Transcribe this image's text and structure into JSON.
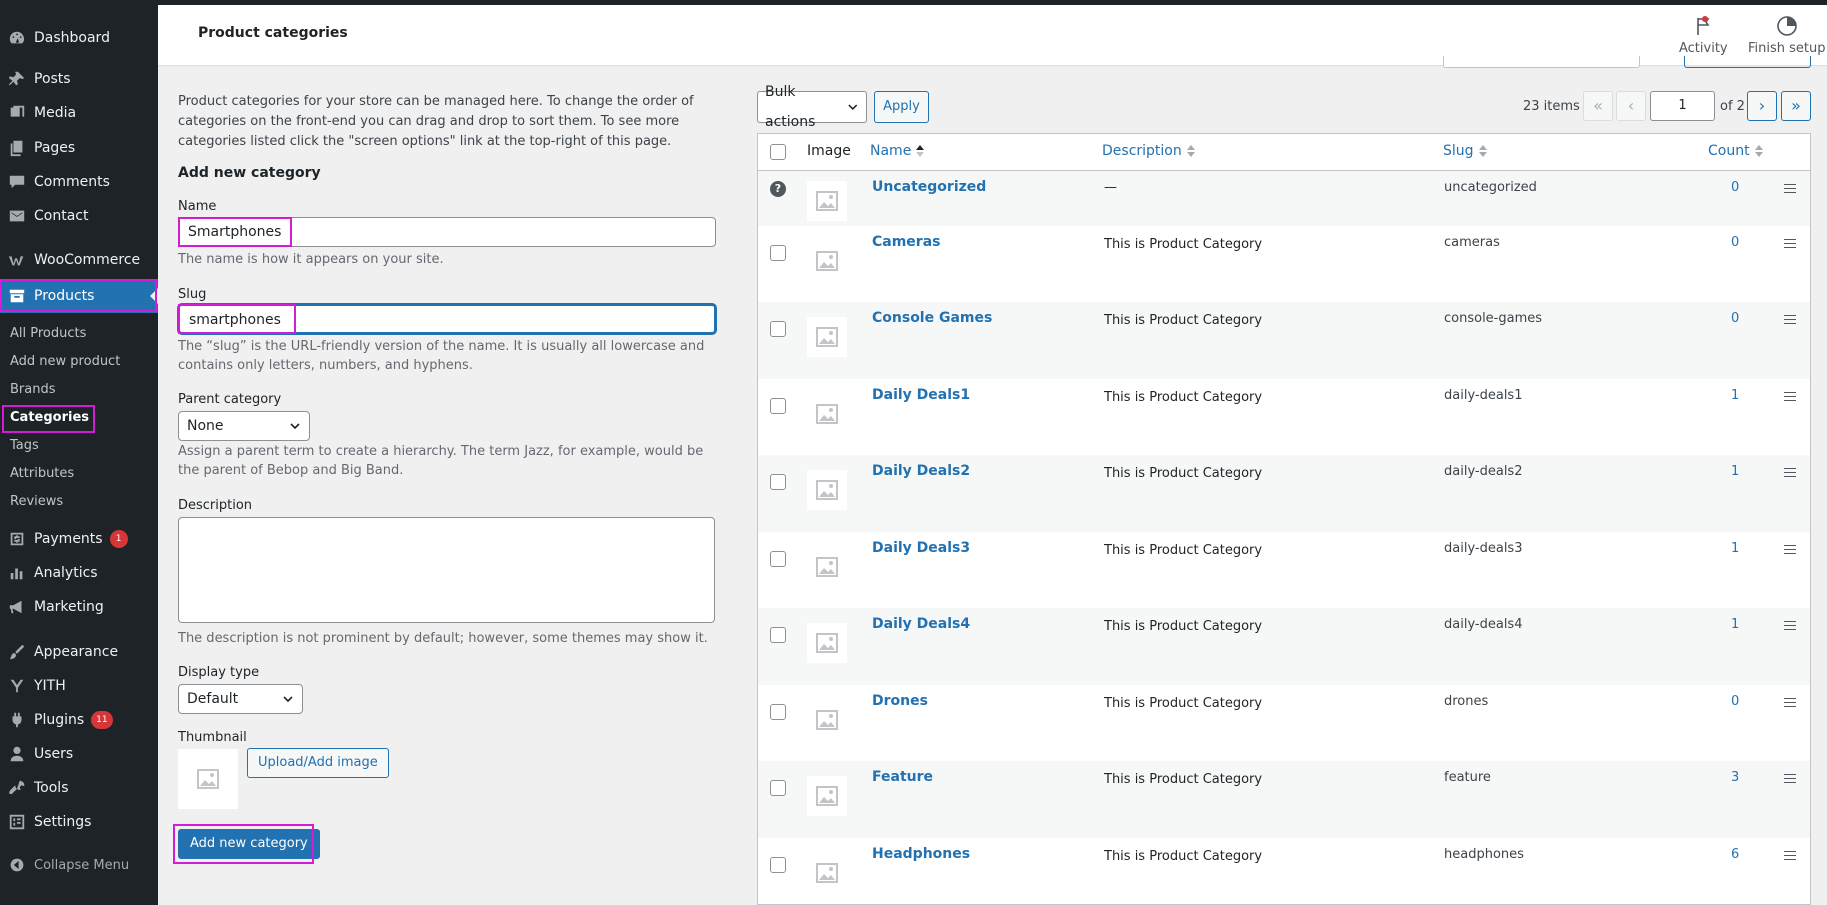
{
  "header": {
    "title": "Product categories",
    "activity_label": "Activity",
    "finish_setup_label": "Finish setup"
  },
  "sidebar": {
    "items": [
      {
        "label": "Dashboard",
        "icon": "dashboard-icon"
      },
      {
        "label": "Posts",
        "icon": "pin-icon"
      },
      {
        "label": "Media",
        "icon": "media-icon"
      },
      {
        "label": "Pages",
        "icon": "pages-icon"
      },
      {
        "label": "Comments",
        "icon": "comment-icon"
      },
      {
        "label": "Contact",
        "icon": "mail-icon"
      },
      {
        "label": "WooCommerce",
        "icon": "woo-icon"
      },
      {
        "label": "Products",
        "icon": "archive-icon"
      },
      {
        "label": "Payments",
        "icon": "payments-icon",
        "badge": "1"
      },
      {
        "label": "Analytics",
        "icon": "chart-icon"
      },
      {
        "label": "Marketing",
        "icon": "megaphone-icon"
      },
      {
        "label": "Appearance",
        "icon": "brush-icon"
      },
      {
        "label": "YITH",
        "icon": "yith-icon"
      },
      {
        "label": "Plugins",
        "icon": "plug-icon",
        "badge": "11"
      },
      {
        "label": "Users",
        "icon": "user-icon"
      },
      {
        "label": "Tools",
        "icon": "wrench-icon"
      },
      {
        "label": "Settings",
        "icon": "settings-icon"
      }
    ],
    "submenu": [
      "All Products",
      "Add new product",
      "Brands",
      "Categories",
      "Tags",
      "Attributes",
      "Reviews"
    ],
    "collapse_label": "Collapse Menu"
  },
  "form": {
    "intro": "Product categories for your store can be managed here. To change the order of categories on the front-end you can drag and drop to sort them. To see more categories listed click the \"screen options\" link at the top-right of this page.",
    "heading": "Add new category",
    "name_label": "Name",
    "name_value": "Smartphones",
    "name_help": "The name is how it appears on your site.",
    "slug_label": "Slug",
    "slug_value": "smartphones",
    "slug_help": "The “slug” is the URL-friendly version of the name. It is usually all lowercase and contains only letters, numbers, and hyphens.",
    "parent_label": "Parent category",
    "parent_value": "None",
    "parent_help": "Assign a parent term to create a hierarchy. The term Jazz, for example, would be the parent of Bebop and Big Band.",
    "description_label": "Description",
    "description_help": "The description is not prominent by default; however, some themes may show it.",
    "display_type_label": "Display type",
    "display_type_value": "Default",
    "thumbnail_label": "Thumbnail",
    "upload_button": "Upload/Add image",
    "submit_button": "Add new category"
  },
  "table": {
    "bulk_actions": "Bulk actions",
    "apply": "Apply",
    "items_count": "23 items",
    "pagination": {
      "first": "«",
      "prev": "‹",
      "current_page": "1",
      "of_pages": "of 2",
      "next": "›",
      "last": "»"
    },
    "columns": {
      "image": "Image",
      "name": "Name",
      "description": "Description",
      "slug": "Slug",
      "count": "Count"
    },
    "rows": [
      {
        "name": "Uncategorized",
        "description": "—",
        "slug": "uncategorized",
        "count": "0"
      },
      {
        "name": "Cameras",
        "description": "This is Product Category",
        "slug": "cameras",
        "count": "0"
      },
      {
        "name": "Console Games",
        "description": "This is Product Category",
        "slug": "console-games",
        "count": "0"
      },
      {
        "name": "Daily Deals1",
        "description": "This is Product Category",
        "slug": "daily-deals1",
        "count": "1"
      },
      {
        "name": "Daily Deals2",
        "description": "This is Product Category",
        "slug": "daily-deals2",
        "count": "1"
      },
      {
        "name": "Daily Deals3",
        "description": "This is Product Category",
        "slug": "daily-deals3",
        "count": "1"
      },
      {
        "name": "Daily Deals4",
        "description": "This is Product Category",
        "slug": "daily-deals4",
        "count": "1"
      },
      {
        "name": "Drones",
        "description": "This is Product Category",
        "slug": "drones",
        "count": "0"
      },
      {
        "name": "Feature",
        "description": "This is Product Category",
        "slug": "feature",
        "count": "3"
      },
      {
        "name": "Headphones",
        "description": "This is Product Category",
        "slug": "headphones",
        "count": "6"
      }
    ]
  },
  "colors": {
    "accent": "#2271b1",
    "highlight": "#d21dd6",
    "sidebar": "#1d2327",
    "badge": "#d63638"
  }
}
